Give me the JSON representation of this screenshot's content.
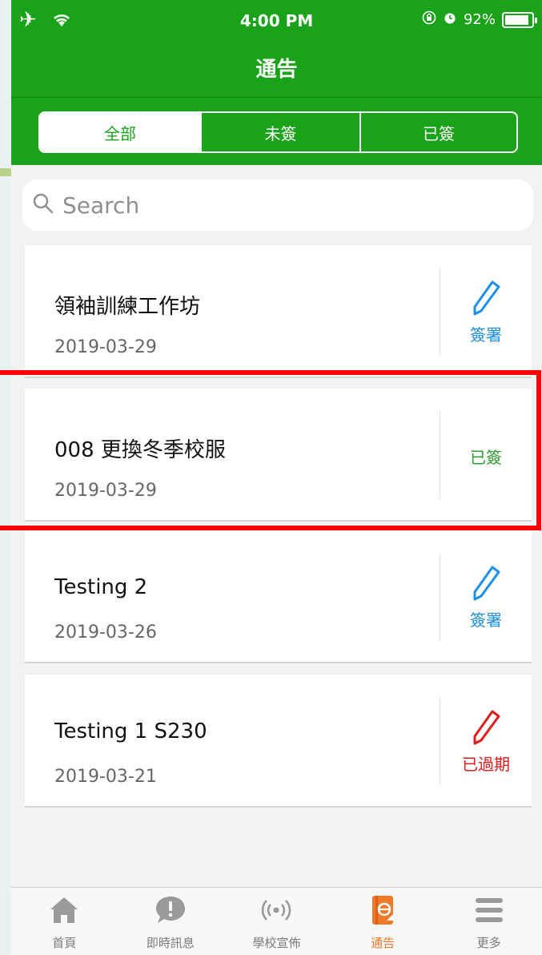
{
  "status_bar": {
    "time": "4:00 PM",
    "battery": "92%",
    "battery_level": 0.92
  },
  "header": {
    "title": "通告",
    "background_color": "#1aa31a"
  },
  "segments": [
    {
      "label": "全部",
      "active": true
    },
    {
      "label": "未簽",
      "active": false
    },
    {
      "label": "已簽",
      "active": false
    }
  ],
  "search": {
    "placeholder": "Search"
  },
  "notices": [
    {
      "title": "領袖訓練工作坊",
      "date": "2019-03-29",
      "action_label": "簽署",
      "action_icon": "pencil-icon",
      "action_color": "#1e8fe6"
    },
    {
      "title": "008 更換冬季校服",
      "date": "2019-03-29",
      "action_label": "已簽",
      "action_icon": "",
      "action_color": "#2f9a2f"
    },
    {
      "title": "Testing 2",
      "date": "2019-03-26",
      "action_label": "簽署",
      "action_icon": "pencil-icon",
      "action_color": "#1e8fe6"
    },
    {
      "title": "Testing 1 S230",
      "date": "2019-03-21",
      "action_label": "已過期",
      "action_icon": "pencil-icon",
      "action_color": "#e01b1b"
    }
  ],
  "tab_bar": {
    "items": [
      {
        "label": "首頁",
        "icon": "home-icon",
        "active": false
      },
      {
        "label": "即時訊息",
        "icon": "message-icon",
        "active": false
      },
      {
        "label": "學校宣佈",
        "icon": "broadcast-icon",
        "active": false
      },
      {
        "label": "通告",
        "icon": "notice-icon",
        "active": true
      },
      {
        "label": "更多",
        "icon": "menu-icon",
        "active": false
      }
    ],
    "active_color": "#f07a2a"
  }
}
